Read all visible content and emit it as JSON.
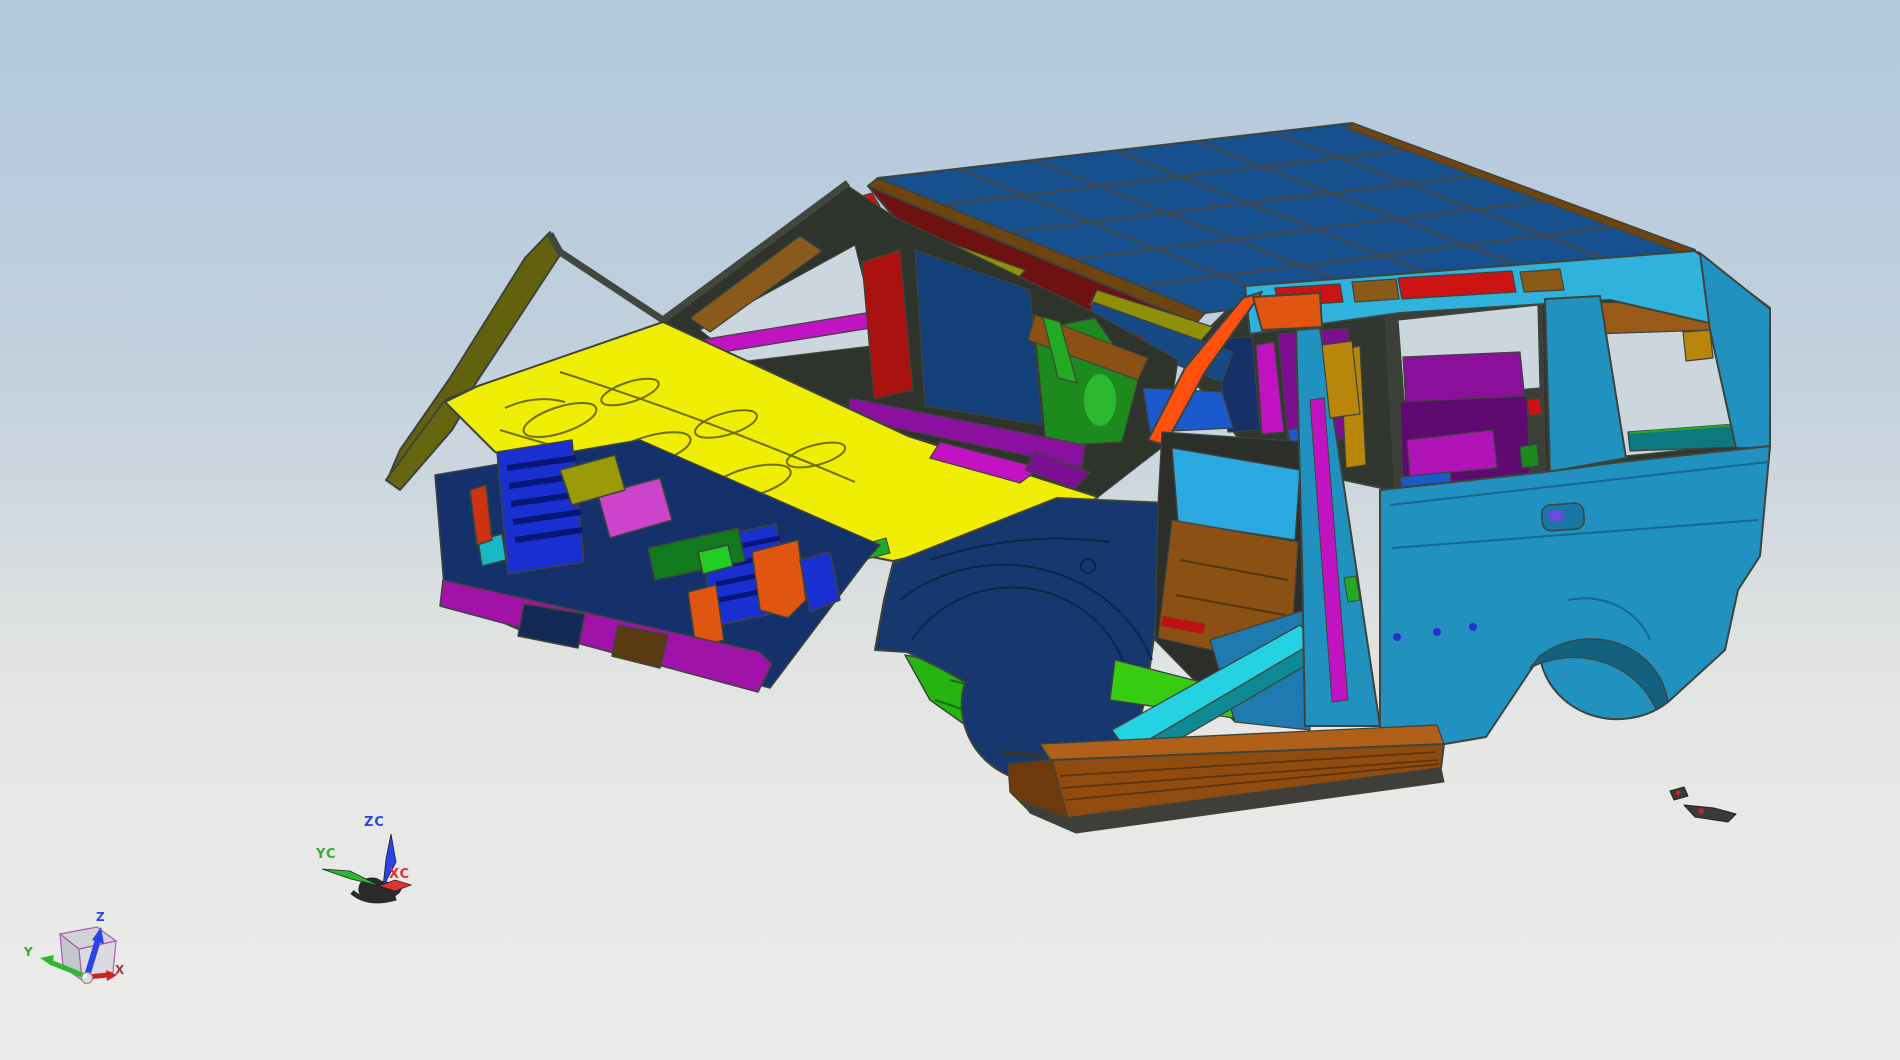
{
  "viewport": {
    "type": "cad-3d-viewport",
    "background_top": "#b2c8dd",
    "background_bottom": "#ebebea"
  },
  "wcs_triad": {
    "z": "ZC",
    "y": "YC",
    "x": "XC",
    "z_color": "#2a44e8",
    "y_color": "#2fae36",
    "x_color": "#e03232"
  },
  "view_cube": {
    "z": "Z",
    "y": "Y",
    "x": "X",
    "z_color": "#2a44e8",
    "y_color": "#2fae36",
    "x_color": "#b03030",
    "cube_edge_color": "#b05ab0"
  },
  "model": {
    "subject": "car body-in-white 3D assembly",
    "palette": {
      "outline": "#3e433c",
      "roof_blue": "#17508e",
      "roof_line": "#42474b",
      "side_blue": "#2191c0",
      "side_shade": "#156d93",
      "rail_cyan": "#2fb3dd",
      "cyan_bright": "#24d2e2",
      "teal_dark": "#0e8a94",
      "navy": "#16386e",
      "navy_dark": "#122a55",
      "royal": "#1a2fd0",
      "box_blue": "#1e2eb8",
      "steel_mid": "#1f7ab0",
      "yellow": "#f0ee04",
      "yellow_shade": "#c9c400",
      "olive": "#66660f",
      "olive_strip": "#8f8f08",
      "gold": "#b8860b",
      "brown_roof": "#6e4410",
      "brown_trim": "#8a5a1c",
      "brown_floor": "#8a5014",
      "rocker_brown": "#8f4c0e",
      "rocker_top": "#b06018",
      "dark_red": "#6e1111",
      "red": "#cc1414",
      "orange": "#ff5010",
      "orange_mid": "#e05510",
      "magenta": "#c213c2",
      "purple": "#7c0f8f",
      "lime": "#35cc12",
      "green": "#1d8a1d",
      "green_bright": "#2eb832",
      "seat_blue": "#1a5acc",
      "interior_dark": "#31362f",
      "sky_through": "#ccd6df",
      "gray_bracket": "#3a3a38"
    },
    "parts": [
      {
        "name": "roof panel",
        "color": "#17508e"
      },
      {
        "name": "hood / cowl top panel",
        "color": "#f0ee04"
      },
      {
        "name": "windshield header",
        "color": "#6e1111"
      },
      {
        "name": "right A-pillar",
        "color": "#ff5010"
      },
      {
        "name": "roof side rail",
        "color": "#2fb3dd"
      },
      {
        "name": "left front fender",
        "color": "#16386e"
      },
      {
        "name": "right front fender",
        "color": "#16386e"
      },
      {
        "name": "radiator support",
        "color": "#1a2fd0"
      },
      {
        "name": "front lower crossmember",
        "color": "#a012a8"
      },
      {
        "name": "front wheelhouse",
        "color": "#24b512"
      },
      {
        "name": "front floor panel",
        "color": "#35cc12"
      },
      {
        "name": "floor pan",
        "color": "#8a5014"
      },
      {
        "name": "door sill inner",
        "color": "#24d2e2"
      },
      {
        "name": "rocker molding",
        "color": "#8f4c0e"
      },
      {
        "name": "B-pillar",
        "color": "#2191c0"
      },
      {
        "name": "quarter panel",
        "color": "#2191c0"
      },
      {
        "name": "cargo trim panel",
        "color": "#7c0f8f"
      },
      {
        "name": "front seat",
        "color": "#1d8a1d"
      },
      {
        "name": "cowl bar",
        "color": "#c213c2"
      },
      {
        "name": "wheel-well box",
        "color": "#1e2eb8"
      }
    ]
  }
}
